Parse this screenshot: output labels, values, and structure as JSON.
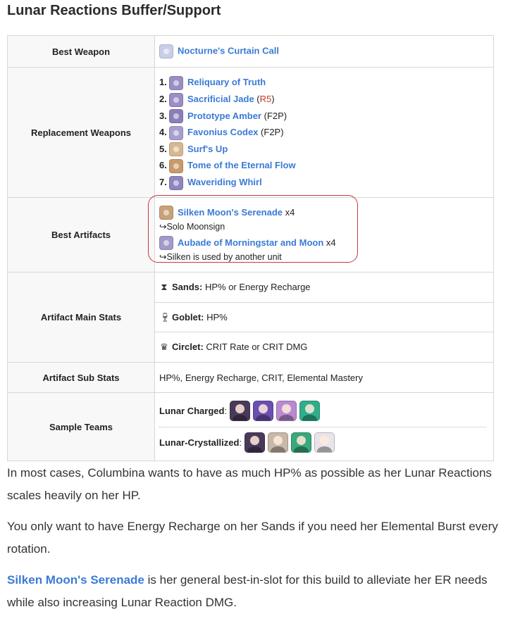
{
  "title": "Lunar Reactions Buffer/Support",
  "best_weapon": {
    "label": "Best Weapon",
    "name": "Nocturne's Curtain Call",
    "icon": "weapon-icon",
    "color": "#c9cfe8"
  },
  "replacement_weapons": {
    "label": "Replacement Weapons",
    "items": [
      {
        "num": "1.",
        "name": "Reliquary of Truth",
        "note": "",
        "color": "#9a8fc4"
      },
      {
        "num": "2.",
        "name": "Sacrificial Jade",
        "note": "R5",
        "color": "#9b8dc6"
      },
      {
        "num": "3.",
        "name": "Prototype Amber",
        "note": "(F2P)",
        "color": "#8b7fba"
      },
      {
        "num": "4.",
        "name": "Favonius Codex",
        "note": "(F2P)",
        "color": "#a89fd0"
      },
      {
        "num": "5.",
        "name": "Surf's Up",
        "note": "",
        "color": "#d7b890"
      },
      {
        "num": "6.",
        "name": "Tome of the Eternal Flow",
        "note": "",
        "color": "#c99a6a"
      },
      {
        "num": "7.",
        "name": "Waveriding Whirl",
        "note": "",
        "color": "#8e86c0"
      }
    ]
  },
  "best_artifacts": {
    "label": "Best Artifacts",
    "set1": {
      "name": "Silken Moon's Serenade",
      "count": "x4",
      "sub": "↪Solo Moonsign",
      "color": "#c9a27a"
    },
    "set2": {
      "name": "Aubade of Morningstar and Moon",
      "count": "x4",
      "sub": "↪Silken is used by another unit",
      "color": "#a49ac9"
    }
  },
  "main_stats": {
    "label": "Artifact Main Stats",
    "sands_label": "Sands:",
    "sands_value": "HP% or Energy Recharge",
    "goblet_label": "Goblet:",
    "goblet_value": "HP%",
    "circlet_label": "Circlet:",
    "circlet_value": "CRIT Rate or CRIT DMG"
  },
  "sub_stats": {
    "label": "Artifact Sub Stats",
    "value": "HP%, Energy Recharge, CRIT, Elemental Mastery"
  },
  "teams": {
    "label": "Sample Teams",
    "team1": {
      "name": "Lunar Charged",
      "colors": [
        "#4a3a5a",
        "#6a4fb0",
        "#b98ad0",
        "#2fae8a"
      ]
    },
    "team2": {
      "name": "Lunar-Crystallized",
      "colors": [
        "#4a3a5a",
        "#c8b8a8",
        "#3aa87c",
        "#e8e4ea"
      ]
    }
  },
  "paragraphs": {
    "p1": "In most cases, Columbina wants to have as much HP% as possible as her Lunar Reactions scales heavily on her HP.",
    "p2": "You only want to have Energy Recharge on her Sands if you need her Elemental Burst every rotation.",
    "p3_link": "Silken Moon's Serenade",
    "p3_rest": " is her general best-in-slot for this build to alleviate her ER needs while also increasing Lunar Reaction DMG."
  }
}
